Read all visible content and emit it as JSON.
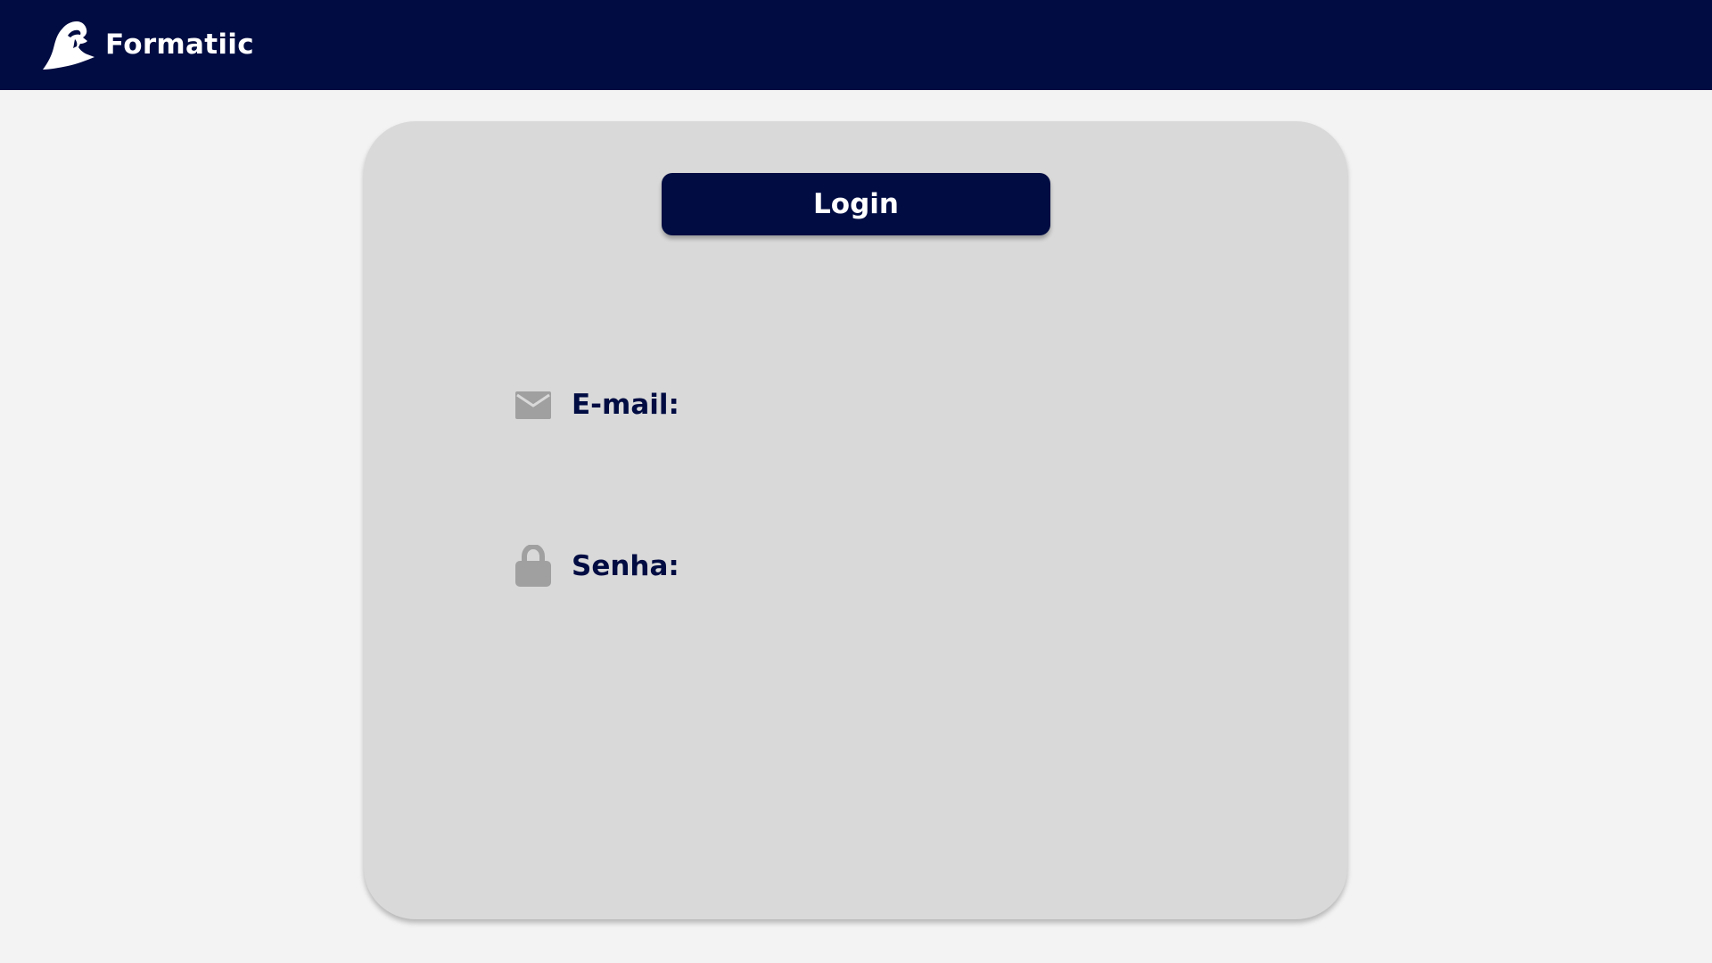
{
  "header": {
    "brand_name": "Formatiic",
    "logo_icon": "hooded-figure-logo-icon",
    "background_color": "#000c42"
  },
  "login_card": {
    "title_button_label": "Login",
    "background_color": "#d9d9d9",
    "fields": [
      {
        "label": "E-mail:",
        "icon": "envelope-icon",
        "value": ""
      },
      {
        "label": "Senha:",
        "icon": "lock-icon",
        "value": ""
      }
    ]
  },
  "colors": {
    "accent": "#000c42",
    "page_background": "#f3f3f3",
    "icon_gray": "#a0a0a0"
  }
}
